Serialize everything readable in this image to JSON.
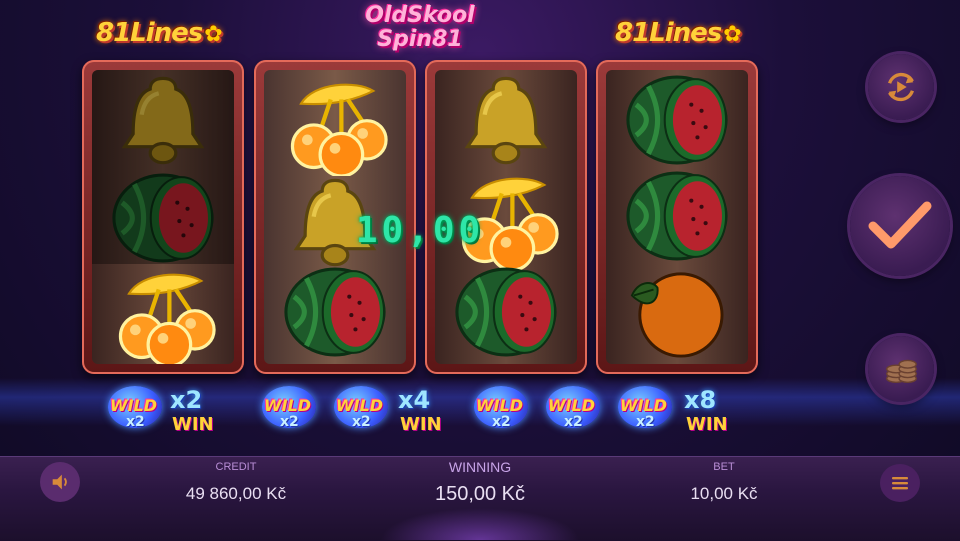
{
  "header": {
    "lines_logo": "81Lines",
    "game_title_line1": "OldSkool",
    "game_title_line2": "Spin81"
  },
  "reels": [
    {
      "symbols": [
        "bell",
        "watermelon",
        "cherries"
      ]
    },
    {
      "symbols": [
        "cherries",
        "bell",
        "watermelon"
      ]
    },
    {
      "symbols": [
        "bell",
        "cherries",
        "watermelon"
      ]
    },
    {
      "symbols": [
        "watermelon",
        "watermelon",
        "orange"
      ]
    }
  ],
  "win_display": "10,00",
  "wild_panel": {
    "wild_label": "WILD",
    "wild_multiplier": "x2",
    "groups": [
      {
        "badges": 1,
        "multiplier": "x2",
        "win_label": "WIN"
      },
      {
        "badges": 2,
        "multiplier": "x4",
        "win_label": "WIN"
      },
      {
        "badges": 3,
        "multiplier": "x8",
        "win_label": "WIN"
      }
    ]
  },
  "controls": {
    "autoplay_icon": "autoplay-icon",
    "spin_icon": "checkmark-icon",
    "bet_icon": "coins-icon",
    "sound_icon": "speaker-icon",
    "menu_icon": "hamburger-icon"
  },
  "status_bar": {
    "credit_label": "CREDIT",
    "credit_value": "49 860,00 Kč",
    "winning_label": "WINNING",
    "winning_value": "150,00 Kč",
    "bet_label": "BET",
    "bet_value": "10,00 Kč"
  },
  "colors": {
    "win_text": "#2ee6a8",
    "accent_orange": "#ffd23a",
    "spin_check": "#ff9a6a"
  }
}
